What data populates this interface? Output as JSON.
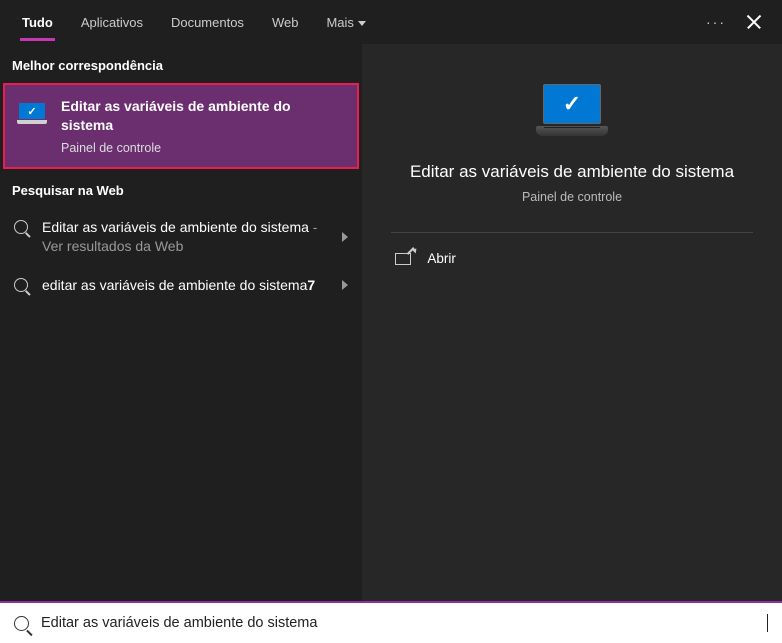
{
  "tabs": {
    "all": "Tudo",
    "apps": "Aplicativos",
    "docs": "Documentos",
    "web": "Web",
    "more": "Mais"
  },
  "left": {
    "bestMatchHeader": "Melhor correspondência",
    "bestMatch": {
      "title": "Editar as variáveis de ambiente do sistema",
      "subtitle": "Painel de controle"
    },
    "webHeader": "Pesquisar na Web",
    "webResults": [
      {
        "primary": "Editar as variáveis de ambiente do sistema",
        "secondary": " - Ver resultados da Web"
      },
      {
        "primary": "editar as variáveis de ambiente do sistema",
        "bold": "7",
        "secondary": ""
      }
    ]
  },
  "preview": {
    "title": "Editar as variáveis de ambiente do sistema",
    "subtitle": "Painel de controle",
    "action": "Abrir"
  },
  "search": {
    "value": "Editar as variáveis de ambiente do sistema"
  }
}
